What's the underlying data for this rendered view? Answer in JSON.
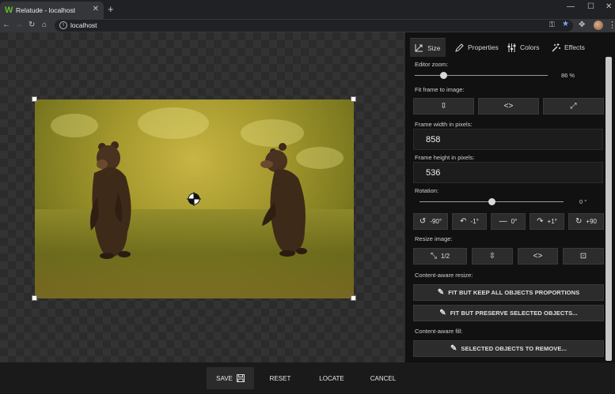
{
  "browser": {
    "tab_title": "Relatude - localhost",
    "favicon_letter": "W",
    "url": "localhost"
  },
  "panel": {
    "tabs": [
      {
        "label": "Size",
        "icon": "size-icon"
      },
      {
        "label": "Properties",
        "icon": "pen-icon"
      },
      {
        "label": "Colors",
        "icon": "sliders-icon"
      },
      {
        "label": "Effects",
        "icon": "magic-wand-icon"
      }
    ],
    "editor_zoom": {
      "label": "Editor zoom:",
      "value_text": "86 %",
      "value": 86
    },
    "fit_frame_label": "Fit frame to image:",
    "frame_width": {
      "label": "Frame width in pixels:",
      "value": "858"
    },
    "frame_height": {
      "label": "Frame height in pixels:",
      "value": "536"
    },
    "rotation": {
      "label": "Rotation:",
      "value_text": "0 °",
      "value": 0,
      "buttons": [
        "-90°",
        "-1°",
        "0°",
        "+1°",
        "+90"
      ]
    },
    "resize_label": "Resize image:",
    "resize_half": "1/2",
    "content_aware_resize_label": "Content-aware resize:",
    "fit_keep": "FIT BUT KEEP ALL OBJECTS PROPORTIONS",
    "fit_preserve": "FIT BUT PRESERVE SELECTED OBJECTS...",
    "content_aware_fill_label": "Content-aware fill:",
    "remove_objects": "SELECTED OBJECTS TO REMOVE..."
  },
  "bottom": {
    "save": "SAVE",
    "reset": "RESET",
    "locate": "LOCATE",
    "cancel": "CANCEL"
  }
}
